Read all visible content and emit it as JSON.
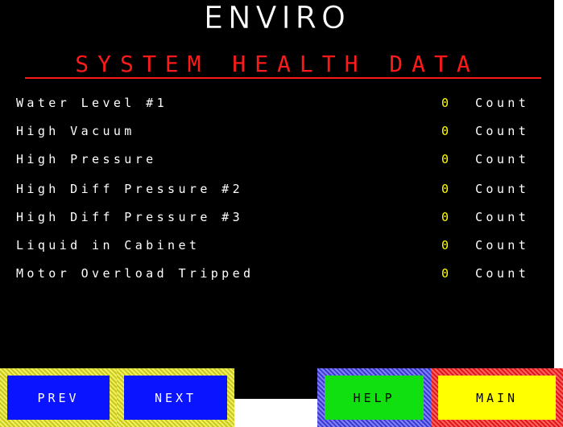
{
  "header": {
    "title": "ENVIRO",
    "subtitle": "SYSTEM HEALTH DATA"
  },
  "rows": [
    {
      "label": "Water Level #1",
      "value": "0",
      "unit": "Count"
    },
    {
      "label": "High Vacuum",
      "value": "0",
      "unit": "Count"
    },
    {
      "label": "High Pressure",
      "value": "0",
      "unit": "Count"
    },
    {
      "label": "High Diff Pressure #2",
      "value": "0",
      "unit": "Count"
    },
    {
      "label": "High Diff Pressure #3",
      "value": "0",
      "unit": "Count"
    },
    {
      "label": "Liquid in Cabinet",
      "value": "0",
      "unit": "Count"
    },
    {
      "label": "Motor Overload Tripped",
      "value": "0",
      "unit": "Count"
    }
  ],
  "buttons": {
    "prev": "PREV",
    "next": "NEXT",
    "help": "HELP",
    "main": "MAIN"
  },
  "colors": {
    "background": "#000000",
    "title": "#ffffff",
    "subtitle": "#ff1a1a",
    "value": "#ffff00",
    "prev_next": "#0a14ff",
    "help": "#10e010",
    "main": "#ffff00"
  }
}
